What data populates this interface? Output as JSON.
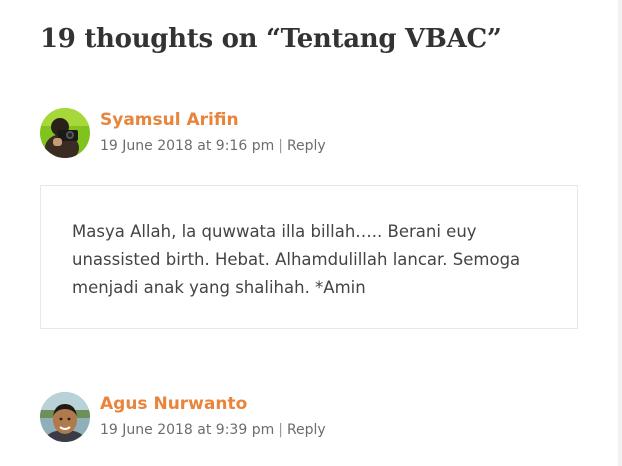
{
  "comments_title": "19 thoughts on “Tentang VBAC”",
  "comments": [
    {
      "author": "Syamsul Arifin",
      "date": "19 June 2018 at 9:16 pm",
      "separator": "|",
      "reply_label": "Reply",
      "text": "Masya Allah, la quwwata illa billah….. Berani euy unassisted birth. Hebat. Alhamdulillah lancar. Semoga menjadi anak yang shalihah. *Amin"
    },
    {
      "author": "Agus Nurwanto",
      "date": "19 June 2018 at 9:39 pm",
      "separator": "|",
      "reply_label": "Reply"
    }
  ],
  "colors": {
    "author_link": "#e8843c",
    "meta_text": "#6d6d6d",
    "body_text": "#444444",
    "border": "#e8e8e8"
  },
  "icons": {
    "avatar_1": "avatar-photographer-green-icon",
    "avatar_2": "avatar-man-outdoor-icon"
  }
}
